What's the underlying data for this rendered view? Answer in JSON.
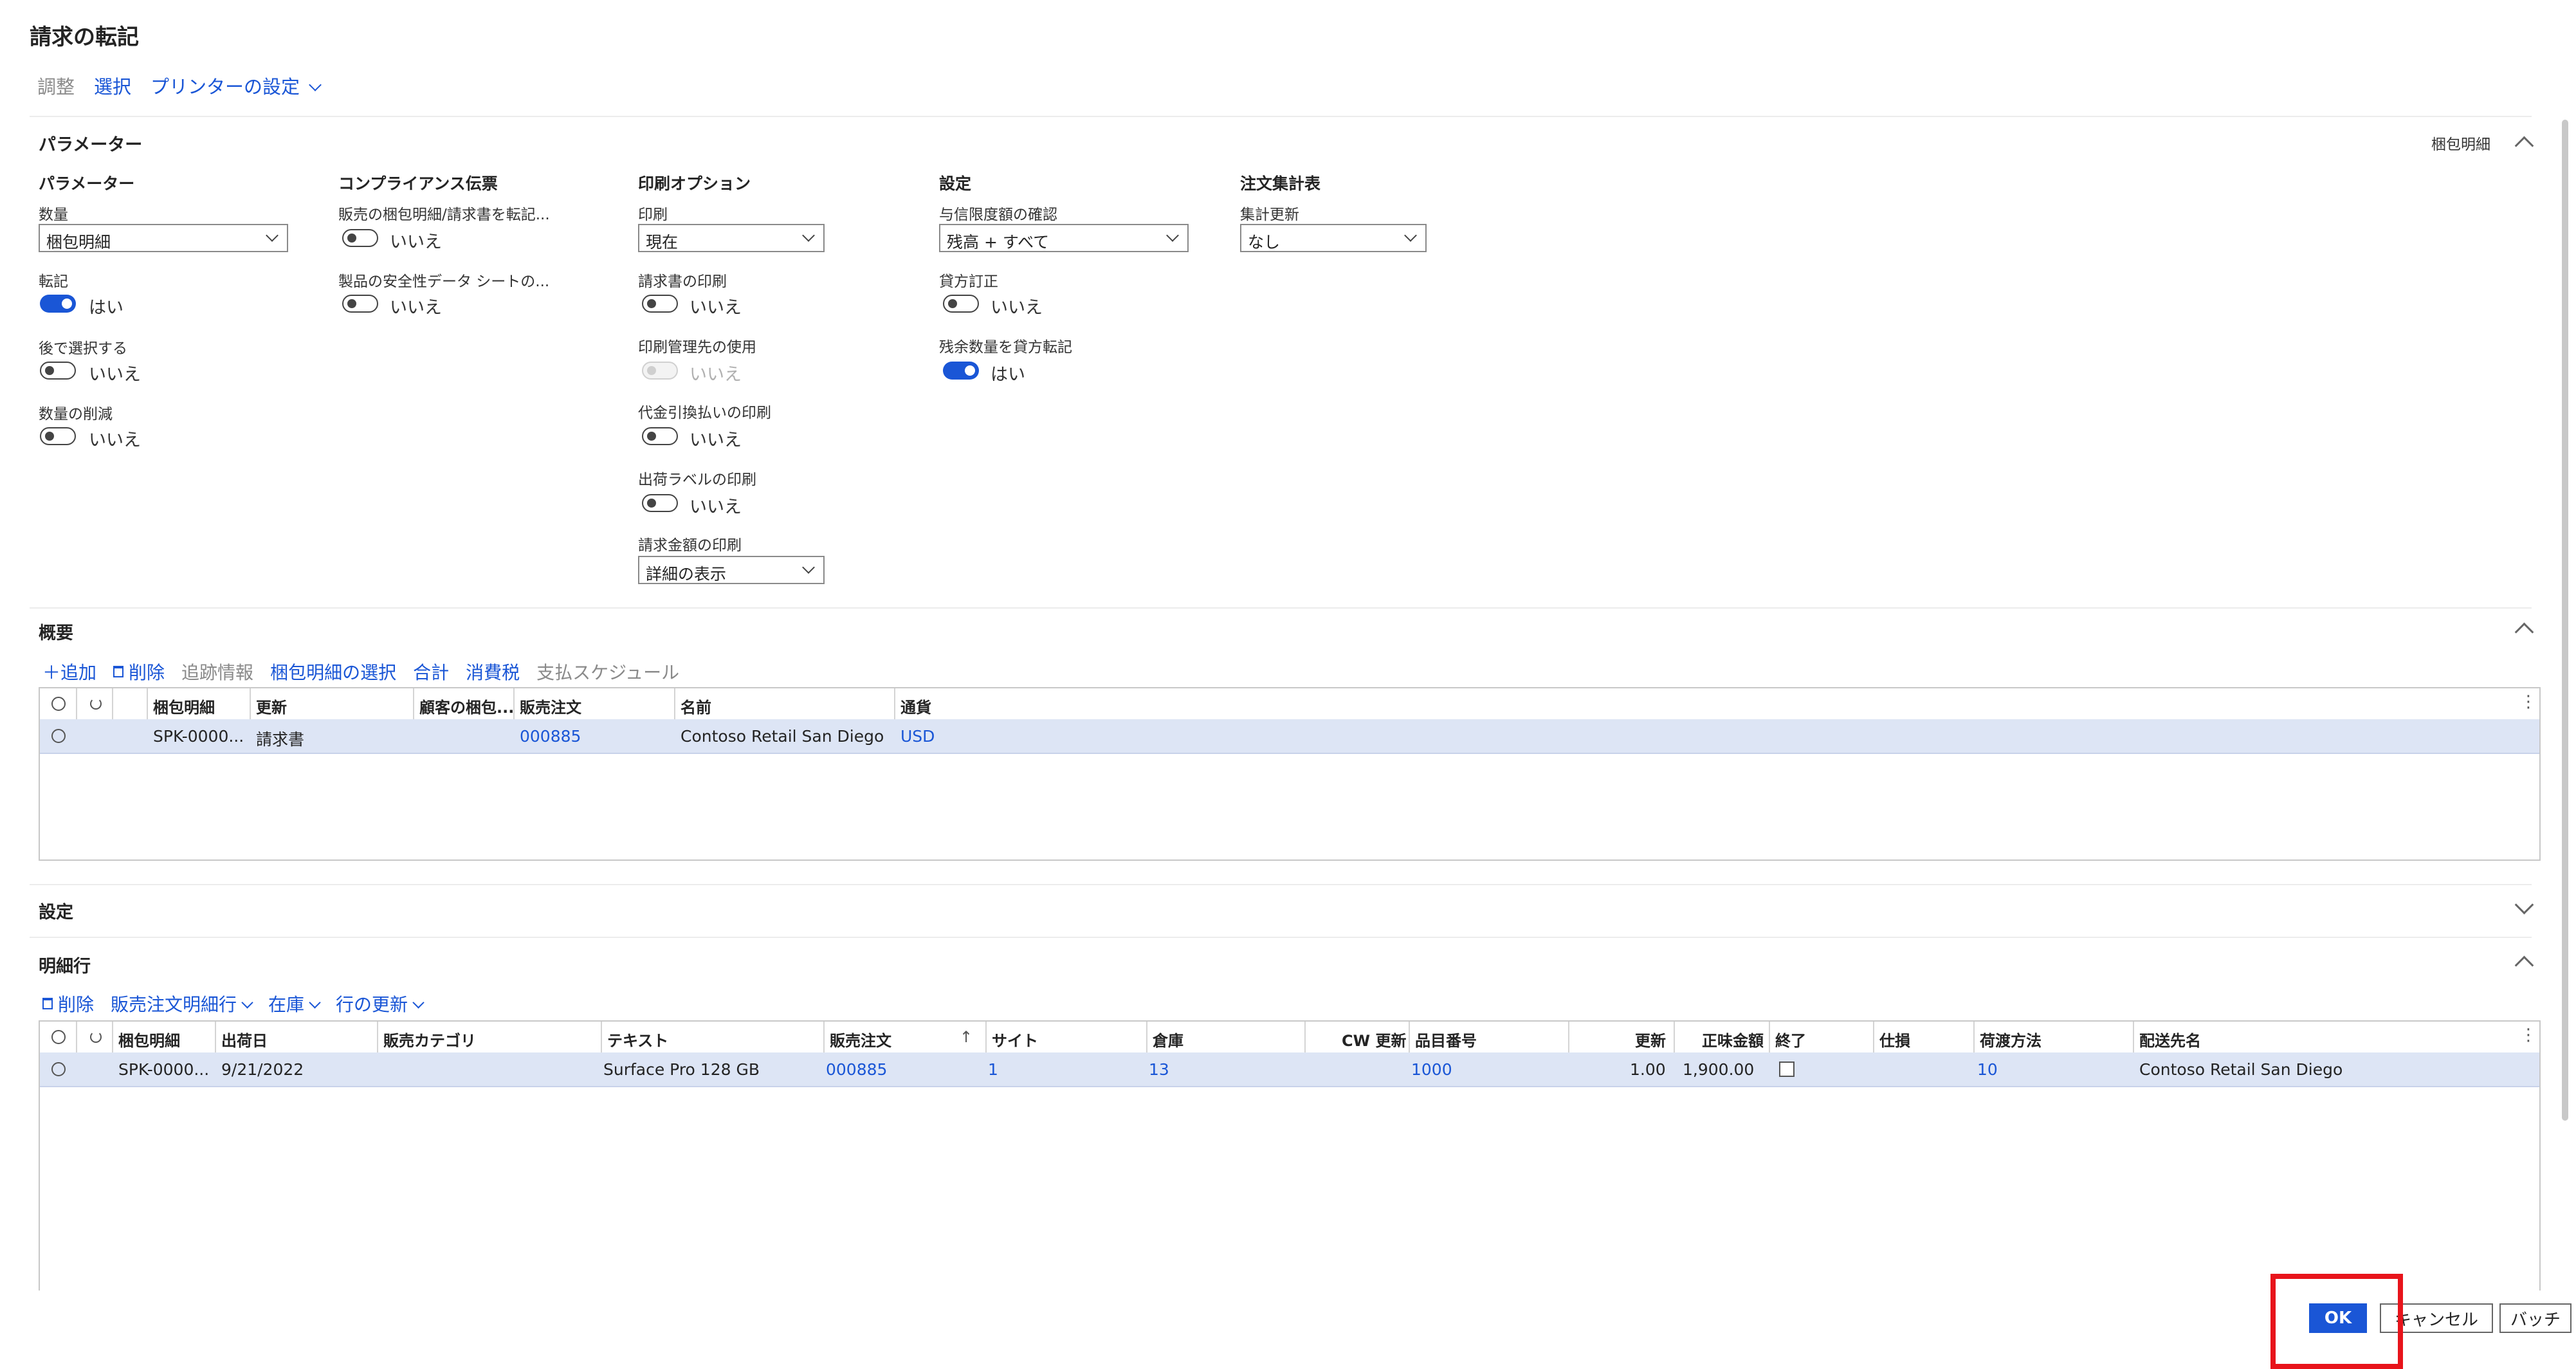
{
  "window": {
    "title": "請求の転記"
  },
  "top_actions": {
    "adjust": "調整",
    "select": "選択",
    "printer_setup": "プリンターの設定"
  },
  "parameters_section": {
    "header": "パラメーター",
    "right_label": "梱包明細",
    "col1": {
      "header": "パラメーター",
      "quantity_label": "数量",
      "quantity_value": "梱包明細",
      "post_label": "転記",
      "post_value": "はい",
      "later_label": "後で選択する",
      "later_value": "いいえ",
      "reduce_label": "数量の削減",
      "reduce_value": "いいえ"
    },
    "col2": {
      "header": "コンプライアンス伝票",
      "sales_label": "販売の梱包明細/請求書を転記...",
      "sales_value": "いいえ",
      "safety_label": "製品の安全性データ シートの...",
      "safety_value": "いいえ"
    },
    "col3": {
      "header": "印刷オプション",
      "print_label": "印刷",
      "print_value": "現在",
      "invoice_print_label": "請求書の印刷",
      "invoice_print_value": "いいえ",
      "print_mgmt_label": "印刷管理先の使用",
      "print_mgmt_value": "いいえ",
      "cod_label": "代金引換払いの印刷",
      "cod_value": "いいえ",
      "ship_label_label": "出荷ラベルの印刷",
      "ship_label_value": "いいえ",
      "amount_print_label": "請求金額の印刷",
      "amount_print_value": "詳細の表示"
    },
    "col4": {
      "header": "設定",
      "credit_label": "与信限度額の確認",
      "credit_value": "残高 + すべて",
      "credit_correction_label": "貸方訂正",
      "credit_correction_value": "いいえ",
      "remaining_label": "残余数量を貸方転記",
      "remaining_value": "はい"
    },
    "col5": {
      "header": "注文集計表",
      "summary_label": "集計更新",
      "summary_value": "なし"
    }
  },
  "overview_section": {
    "header": "概要",
    "toolbar": {
      "add": "追加",
      "delete": "削除",
      "tracking": "追跡情報",
      "select_packing": "梱包明細の選択",
      "total": "合計",
      "tax": "消費税",
      "payment_schedule": "支払スケジュール"
    },
    "columns": [
      "梱包明細",
      "更新",
      "顧客の梱包...",
      "販売注文",
      "名前",
      "通貨"
    ],
    "rows": [
      [
        "SPK-0000...",
        "請求書",
        "",
        "000885",
        "Contoso Retail San Diego",
        "USD"
      ]
    ]
  },
  "settings_section": {
    "header": "設定"
  },
  "lines_section": {
    "header": "明細行",
    "toolbar": {
      "delete": "削除",
      "sales_order_line": "販売注文明細行",
      "inventory": "在庫",
      "update_line": "行の更新"
    },
    "columns": [
      "梱包明細",
      "出荷日",
      "販売カテゴリ",
      "テキスト",
      "販売注文",
      "サイト",
      "倉庫",
      "CW 更新",
      "品目番号",
      "更新",
      "正味金額",
      "終了",
      "仕損",
      "荷渡方法",
      "配送先名"
    ],
    "rows": [
      [
        "SPK-0000...",
        "9/21/2022",
        "",
        "Surface Pro 128 GB",
        "000885",
        "1",
        "13",
        "",
        "1000",
        "1.00",
        "1,900.00",
        "",
        "",
        "10",
        "Contoso Retail San Diego"
      ]
    ]
  },
  "footer": {
    "ok": "OK",
    "cancel": "キャンセル",
    "batch": "バッチ"
  },
  "colors": {
    "accent": "#1a56d6",
    "highlight": "#e8141b",
    "row_selected": "#dde5f5"
  }
}
